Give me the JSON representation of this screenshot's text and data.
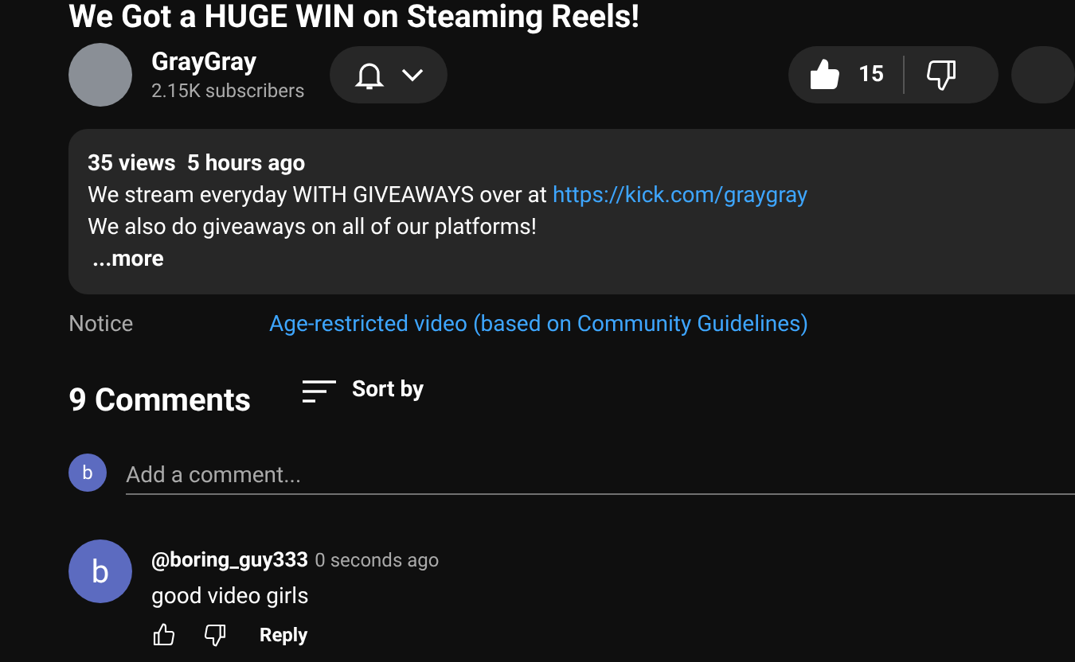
{
  "video": {
    "title": "We Got a HUGE WIN on Steaming Reels!"
  },
  "channel": {
    "name": "GrayGray",
    "subscribers": "2.15K subscribers",
    "notifications_on": true
  },
  "likes": {
    "count": "15",
    "liked": true
  },
  "description": {
    "stats": "35 views  5 hours ago",
    "line_1": "We stream everyday WITH GIVEAWAYS over at ",
    "link": "https://kick.com/graygray",
    "line_2": "We also do giveaways on all of our platforms!",
    "more": "...more"
  },
  "notice": {
    "label": "Notice",
    "link": "Age-restricted video (based on Community Guidelines)"
  },
  "comments": {
    "count_label": "9 Comments",
    "sort_label": "Sort by",
    "add_placeholder": "Add a comment...",
    "user_initial": "b",
    "items": [
      {
        "initial": "b",
        "author": "@boring_guy333",
        "time": "0 seconds ago",
        "text": "good video girls",
        "reply": "Reply"
      }
    ]
  }
}
